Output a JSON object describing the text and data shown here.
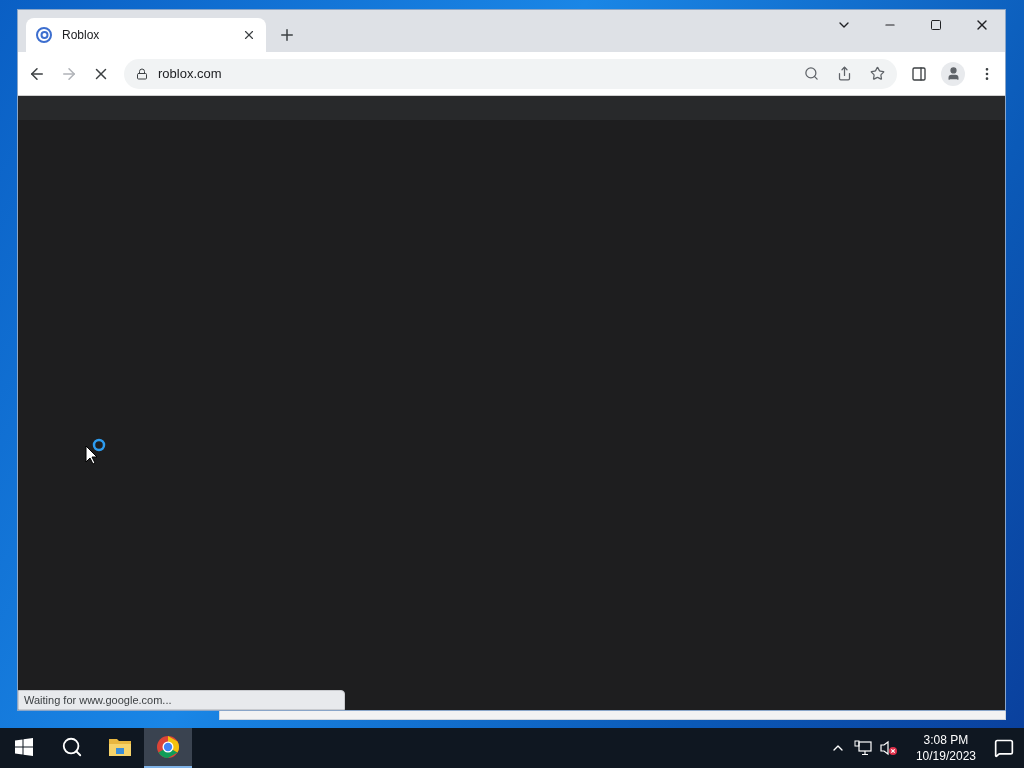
{
  "browser": {
    "tab": {
      "title": "Roblox",
      "selected": true
    },
    "address": "roblox.com",
    "loading": true,
    "status": "Waiting for www.google.com..."
  },
  "taskbar": {
    "apps": [
      {
        "kind": "explorer",
        "selected": false
      },
      {
        "kind": "chrome",
        "selected": true
      }
    ],
    "time": "3:08 PM",
    "date": "10/19/2023",
    "sound_muted": true
  }
}
